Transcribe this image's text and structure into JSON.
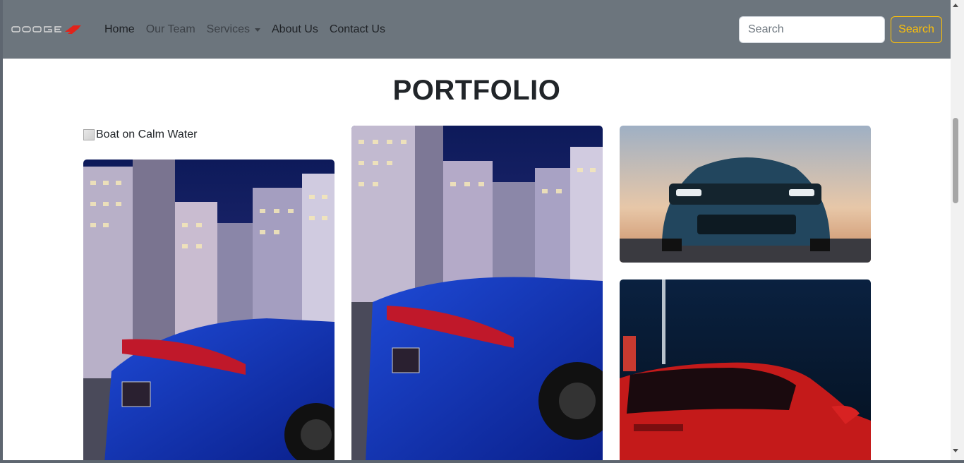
{
  "navbar": {
    "brand": "DODGE",
    "links": [
      {
        "label": "Home"
      },
      {
        "label": "Our Team"
      },
      {
        "label": "Services"
      },
      {
        "label": "About Us"
      },
      {
        "label": "Contact Us"
      }
    ],
    "search": {
      "placeholder": "Search",
      "button_label": "Search"
    },
    "colors": {
      "background": "#6c757d",
      "accent": "#ffc107",
      "brand_red": "#e2231a"
    }
  },
  "main": {
    "title": "PORTFOLIO",
    "broken_image_alt": "Boat on Calm Water"
  }
}
